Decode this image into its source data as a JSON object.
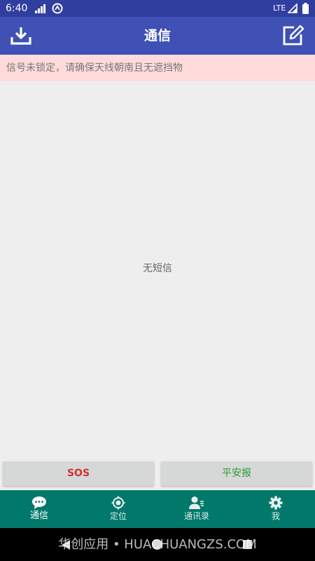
{
  "status_bar": {
    "time": "6:40",
    "network_type": "LTE"
  },
  "app_bar": {
    "title": "通信",
    "left_icon": "download-icon",
    "right_icon": "compose-icon"
  },
  "warning": {
    "text": "信号未锁定，请确保天线朝南且无遮挡物",
    "background": "#ffdbdb"
  },
  "content": {
    "empty_text": "无短信"
  },
  "actions": {
    "sos_label": "SOS",
    "sos_color": "#d32f2f",
    "safe_label": "平安报",
    "safe_color": "#2e9b2e"
  },
  "bottom_nav": {
    "active_index": 0,
    "items": [
      {
        "label": "通信",
        "icon": "chat-icon"
      },
      {
        "label": "定位",
        "icon": "location-icon"
      },
      {
        "label": "通讯录",
        "icon": "contacts-icon"
      },
      {
        "label": "我",
        "icon": "gear-icon"
      }
    ]
  },
  "watermark": {
    "text": "华创应用 • HUACHUANGZS.COM"
  },
  "colors": {
    "status_bar": "#303f9f",
    "app_bar": "#3f51b5",
    "bottom_nav": "#00796b"
  }
}
